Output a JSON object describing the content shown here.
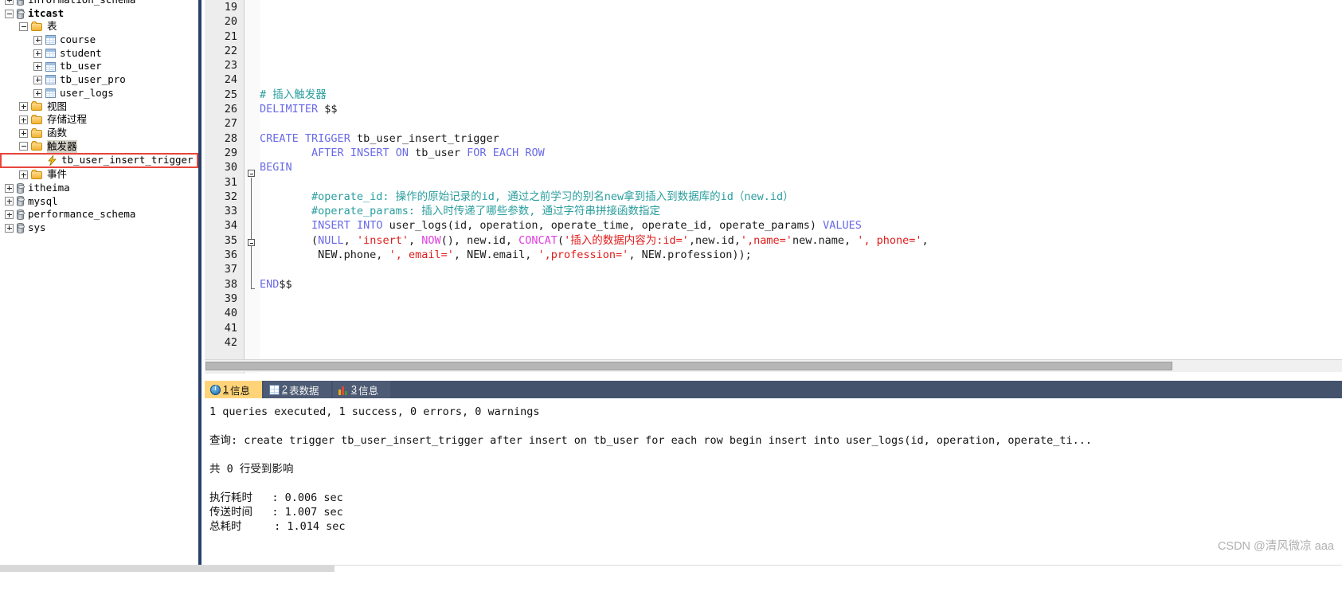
{
  "tree": {
    "nodes": [
      {
        "indent": 0,
        "toggle": "plus",
        "icon": "db-icon",
        "label": "information_schema",
        "clipped": true,
        "bold": false,
        "selected": false
      },
      {
        "indent": 0,
        "toggle": "minus",
        "icon": "db-icon",
        "label": "itcast",
        "clipped": false,
        "bold": true,
        "selected": false
      },
      {
        "indent": 1,
        "toggle": "minus",
        "icon": "folder-icon",
        "label": "表",
        "clipped": false,
        "bold": false,
        "selected": false
      },
      {
        "indent": 2,
        "toggle": "plus",
        "icon": "table-icon",
        "label": "course",
        "clipped": false,
        "bold": false,
        "selected": false
      },
      {
        "indent": 2,
        "toggle": "plus",
        "icon": "table-icon",
        "label": "student",
        "clipped": false,
        "bold": false,
        "selected": false
      },
      {
        "indent": 2,
        "toggle": "plus",
        "icon": "table-icon",
        "label": "tb_user",
        "clipped": false,
        "bold": false,
        "selected": false
      },
      {
        "indent": 2,
        "toggle": "plus",
        "icon": "table-icon",
        "label": "tb_user_pro",
        "clipped": false,
        "bold": false,
        "selected": false
      },
      {
        "indent": 2,
        "toggle": "plus",
        "icon": "table-icon",
        "label": "user_logs",
        "clipped": false,
        "bold": false,
        "selected": false
      },
      {
        "indent": 1,
        "toggle": "plus",
        "icon": "folder-icon",
        "label": "视图",
        "clipped": false,
        "bold": false,
        "selected": false
      },
      {
        "indent": 1,
        "toggle": "plus",
        "icon": "folder-icon",
        "label": "存储过程",
        "clipped": false,
        "bold": false,
        "selected": false
      },
      {
        "indent": 1,
        "toggle": "plus",
        "icon": "folder-icon",
        "label": "函数",
        "clipped": false,
        "bold": false,
        "selected": false
      },
      {
        "indent": 1,
        "toggle": "minus",
        "icon": "folder-icon",
        "label": "触发器",
        "clipped": false,
        "bold": false,
        "selected": true
      },
      {
        "indent": 2,
        "toggle": "none",
        "icon": "trigger-icon",
        "label": "tb_user_insert_trigger",
        "clipped": false,
        "bold": false,
        "selected": false,
        "highlight": true
      },
      {
        "indent": 1,
        "toggle": "plus",
        "icon": "folder-icon",
        "label": "事件",
        "clipped": false,
        "bold": false,
        "selected": false
      },
      {
        "indent": 0,
        "toggle": "plus",
        "icon": "db-icon",
        "label": "itheima",
        "clipped": false,
        "bold": false,
        "selected": false
      },
      {
        "indent": 0,
        "toggle": "plus",
        "icon": "db-icon",
        "label": "mysql",
        "clipped": false,
        "bold": false,
        "selected": false
      },
      {
        "indent": 0,
        "toggle": "plus",
        "icon": "db-icon",
        "label": "performance_schema",
        "clipped": false,
        "bold": false,
        "selected": false
      },
      {
        "indent": 0,
        "toggle": "plus",
        "icon": "db-icon",
        "label": "sys",
        "clipped": false,
        "bold": false,
        "selected": false
      }
    ]
  },
  "editor": {
    "first_line_number": 19,
    "last_line_number": 42,
    "line_numbers": [
      19,
      20,
      21,
      22,
      23,
      24,
      25,
      26,
      27,
      28,
      29,
      30,
      31,
      32,
      33,
      34,
      35,
      36,
      37,
      38,
      39,
      40,
      41,
      42
    ],
    "lines": [
      {
        "n": 19,
        "segments": []
      },
      {
        "n": 20,
        "segments": []
      },
      {
        "n": 21,
        "segments": []
      },
      {
        "n": 22,
        "segments": []
      },
      {
        "n": 23,
        "segments": []
      },
      {
        "n": 24,
        "segments": []
      },
      {
        "n": 25,
        "segments": [
          {
            "t": "# 插入触发器",
            "c": "cmt"
          }
        ]
      },
      {
        "n": 26,
        "segments": [
          {
            "t": "DELIMITER",
            "c": "kw"
          },
          {
            "t": " $$",
            "c": "pln"
          }
        ]
      },
      {
        "n": 27,
        "segments": []
      },
      {
        "n": 28,
        "segments": [
          {
            "t": "CREATE",
            "c": "kw"
          },
          {
            "t": " ",
            "c": "pln"
          },
          {
            "t": "TRIGGER",
            "c": "kw"
          },
          {
            "t": " tb_user_insert_trigger",
            "c": "pln"
          }
        ]
      },
      {
        "n": 29,
        "segments": [
          {
            "t": "        ",
            "c": "pln"
          },
          {
            "t": "AFTER",
            "c": "kw"
          },
          {
            "t": " ",
            "c": "pln"
          },
          {
            "t": "INSERT",
            "c": "kw"
          },
          {
            "t": " ",
            "c": "pln"
          },
          {
            "t": "ON",
            "c": "kw"
          },
          {
            "t": " tb_user ",
            "c": "pln"
          },
          {
            "t": "FOR",
            "c": "kw"
          },
          {
            "t": " ",
            "c": "pln"
          },
          {
            "t": "EACH",
            "c": "kw"
          },
          {
            "t": " ",
            "c": "pln"
          },
          {
            "t": "ROW",
            "c": "kw"
          }
        ]
      },
      {
        "n": 30,
        "segments": [
          {
            "t": "BEGIN",
            "c": "kw"
          }
        ]
      },
      {
        "n": 31,
        "segments": []
      },
      {
        "n": 32,
        "segments": [
          {
            "t": "        #operate_id: 操作的原始记录的id, 通过之前学习的别名new拿到插入到数据库的id（new.id）",
            "c": "cmt"
          }
        ]
      },
      {
        "n": 33,
        "segments": [
          {
            "t": "        #operate_params: 插入时传递了哪些参数, 通过字符串拼接函数指定",
            "c": "cmt"
          }
        ]
      },
      {
        "n": 34,
        "segments": [
          {
            "t": "        ",
            "c": "pln"
          },
          {
            "t": "INSERT",
            "c": "kw"
          },
          {
            "t": " ",
            "c": "pln"
          },
          {
            "t": "INTO",
            "c": "kw"
          },
          {
            "t": " user_logs(id, operation, operate_time, operate_id, operate_params) ",
            "c": "pln"
          },
          {
            "t": "VALUES",
            "c": "kw"
          }
        ]
      },
      {
        "n": 35,
        "segments": [
          {
            "t": "        (",
            "c": "pln"
          },
          {
            "t": "NULL",
            "c": "kw"
          },
          {
            "t": ", ",
            "c": "pln"
          },
          {
            "t": "'insert'",
            "c": "str"
          },
          {
            "t": ", ",
            "c": "pln"
          },
          {
            "t": "NOW",
            "c": "fn"
          },
          {
            "t": "(), new.id, ",
            "c": "pln"
          },
          {
            "t": "CONCAT",
            "c": "fn"
          },
          {
            "t": "(",
            "c": "pln"
          },
          {
            "t": "'插入的数据内容为:id='",
            "c": "str"
          },
          {
            "t": ",new.id,",
            "c": "pln"
          },
          {
            "t": "',name='",
            "c": "str"
          },
          {
            "t": "new.name, ",
            "c": "pln"
          },
          {
            "t": "', phone='",
            "c": "str"
          },
          {
            "t": ",",
            "c": "pln"
          }
        ]
      },
      {
        "n": 36,
        "segments": [
          {
            "t": "         NEW.phone, ",
            "c": "pln"
          },
          {
            "t": "', email='",
            "c": "str"
          },
          {
            "t": ", NEW.email, ",
            "c": "pln"
          },
          {
            "t": "',profession='",
            "c": "str"
          },
          {
            "t": ", NEW.profession));",
            "c": "pln"
          }
        ]
      },
      {
        "n": 37,
        "segments": []
      },
      {
        "n": 38,
        "segments": [
          {
            "t": "END",
            "c": "kw"
          },
          {
            "t": "$$",
            "c": "pln"
          }
        ]
      },
      {
        "n": 39,
        "segments": []
      },
      {
        "n": 40,
        "segments": []
      },
      {
        "n": 41,
        "segments": []
      },
      {
        "n": 42,
        "segments": []
      }
    ]
  },
  "result": {
    "tabs": [
      {
        "num": "1",
        "label": "信息",
        "icon": "info-icon",
        "active": true
      },
      {
        "num": "2",
        "label": "表数据",
        "icon": "grid-icon",
        "active": false
      },
      {
        "num": "3",
        "label": "信息",
        "icon": "chart-icon",
        "active": false
      }
    ],
    "lines": [
      "1 queries executed, 1 success, 0 errors, 0 warnings",
      "",
      "查询: create trigger tb_user_insert_trigger after insert on tb_user for each row begin insert into user_logs(id, operation, operate_ti...",
      "",
      "共 0 行受到影响",
      "",
      "执行耗时   : 0.006 sec",
      "传送时间   : 1.007 sec",
      "总耗时     : 1.014 sec"
    ]
  },
  "watermark": {
    "text": "CSDN @清风微凉 aaa"
  }
}
